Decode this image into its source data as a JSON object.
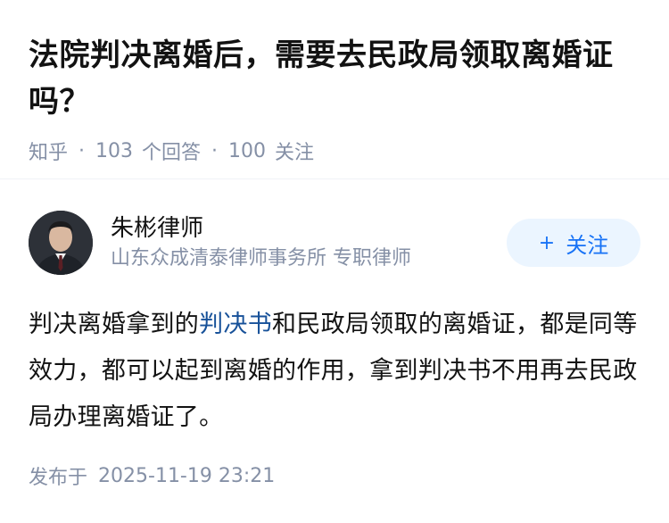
{
  "question": {
    "title": "法院判决离婚后，需要去民政局领取离婚证吗？",
    "source": "知乎",
    "answer_count": "103",
    "answer_label": "个回答",
    "follower_count": "100",
    "follower_label": "关注"
  },
  "answer": {
    "author_name": "朱彬律师",
    "author_desc": "山东众成清泰律师事务所 专职律师",
    "follow_button": {
      "icon": "+",
      "label": "关注"
    },
    "content_before": "判决离婚拿到的",
    "content_link": "判决书",
    "content_after": "和民政局领取的离婚证，都是同等效力，都可以起到离婚的作用，拿到判决书不用再去民政局办理离婚证了。",
    "publish_label": "发布于",
    "publish_time": "2025-11-19 23:21"
  },
  "colors": {
    "link": "#175199",
    "accent": "#1772f6",
    "meta": "#8590a6",
    "follow_bg": "#ebf5ff"
  }
}
